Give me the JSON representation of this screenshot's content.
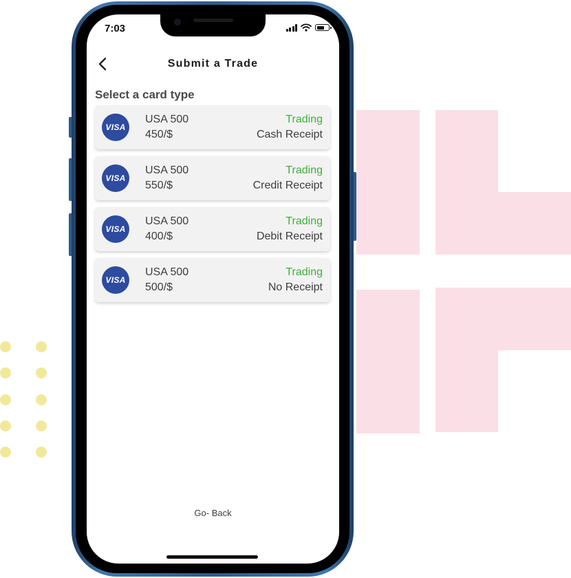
{
  "status_bar": {
    "time": "7:03"
  },
  "header": {
    "back_icon": "chevron-left-icon",
    "title": "Submit a Trade"
  },
  "section_label": "Select a card type",
  "cards": [
    {
      "brand": "VISA",
      "name": "USA 500",
      "rate": "450/$",
      "status": "Trading",
      "receipt": "Cash Receipt"
    },
    {
      "brand": "VISA",
      "name": "USA 500",
      "rate": "550/$",
      "status": "Trading",
      "receipt": "Credit Receipt"
    },
    {
      "brand": "VISA",
      "name": "USA 500",
      "rate": "400/$",
      "status": "Trading",
      "receipt": "Debit Receipt"
    },
    {
      "brand": "VISA",
      "name": "USA 500",
      "rate": "500/$",
      "status": "Trading",
      "receipt": "No Receipt"
    }
  ],
  "footer": {
    "go_back": "Go- Back"
  },
  "colors": {
    "status_green": "#3fae3b",
    "visa_blue": "#2d4b9f",
    "phone_blue": "#2c5b8c",
    "deco_pink": "#fbdfe6",
    "deco_yellow": "#f1e99a"
  }
}
